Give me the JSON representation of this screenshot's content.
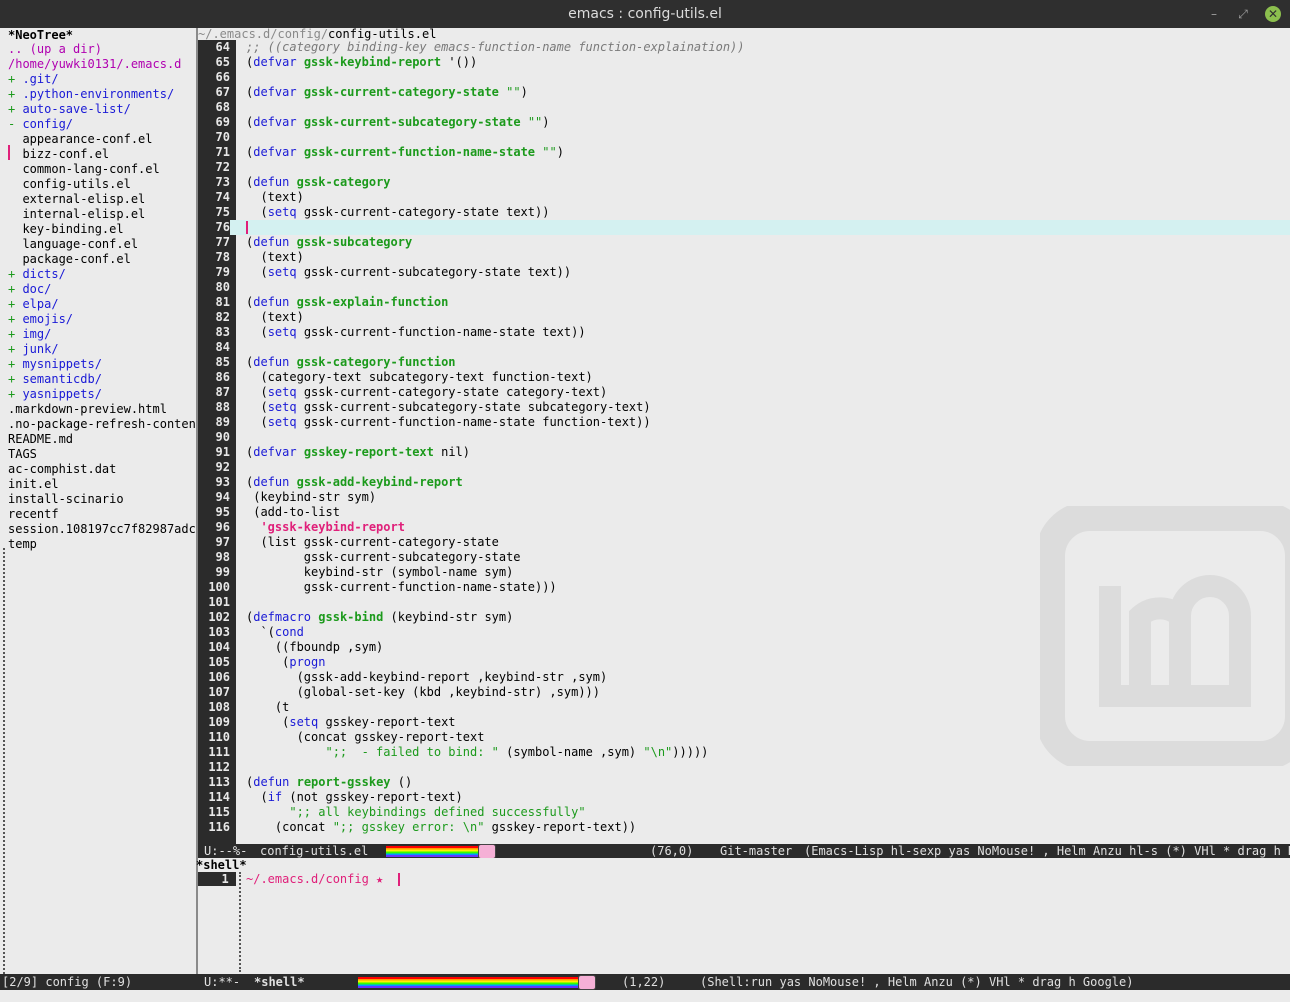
{
  "window": {
    "title": "emacs : config-utils.el",
    "min": "–",
    "max": "⤢",
    "close": "✕"
  },
  "neotree": {
    "header": "*NeoTree*",
    "lines": [
      {
        "prefix": "..",
        "label": " (up a dir)",
        "kind": "up"
      },
      {
        "prefix": "",
        "label": "/home/yuwki0131/.emacs.d",
        "kind": "root"
      },
      {
        "prefix": "+",
        "label": " .git/",
        "kind": "dir"
      },
      {
        "prefix": "+",
        "label": " .python-environments/",
        "kind": "dir"
      },
      {
        "prefix": "+",
        "label": " auto-save-list/",
        "kind": "dir"
      },
      {
        "prefix": "-",
        "label": " config/",
        "kind": "dir"
      },
      {
        "prefix": "",
        "label": "  appearance-conf.el",
        "kind": "file"
      },
      {
        "prefix": "",
        "label": "  bizz-conf.el",
        "kind": "file"
      },
      {
        "prefix": "",
        "label": "  common-lang-conf.el",
        "kind": "file"
      },
      {
        "prefix": "",
        "label": "  config-utils.el",
        "kind": "file"
      },
      {
        "prefix": "",
        "label": "  external-elisp.el",
        "kind": "file"
      },
      {
        "prefix": "",
        "label": "  internal-elisp.el",
        "kind": "file"
      },
      {
        "prefix": "",
        "label": "  key-binding.el",
        "kind": "file"
      },
      {
        "prefix": "",
        "label": "  language-conf.el",
        "kind": "file"
      },
      {
        "prefix": "",
        "label": "  package-conf.el",
        "kind": "file"
      },
      {
        "prefix": "+",
        "label": " dicts/",
        "kind": "dir"
      },
      {
        "prefix": "+",
        "label": " doc/",
        "kind": "dir"
      },
      {
        "prefix": "+",
        "label": " elpa/",
        "kind": "dir"
      },
      {
        "prefix": "+",
        "label": " emojis/",
        "kind": "dir"
      },
      {
        "prefix": "+",
        "label": " img/",
        "kind": "dir"
      },
      {
        "prefix": "+",
        "label": " junk/",
        "kind": "dir"
      },
      {
        "prefix": "+",
        "label": " mysnippets/",
        "kind": "dir"
      },
      {
        "prefix": "+",
        "label": " semanticdb/",
        "kind": "dir"
      },
      {
        "prefix": "+",
        "label": " yasnippets/",
        "kind": "dir"
      },
      {
        "prefix": "",
        "label": ".markdown-preview.html",
        "kind": "file"
      },
      {
        "prefix": "",
        "label": ".no-package-refresh-conten",
        "kind": "file"
      },
      {
        "prefix": "",
        "label": "README.md",
        "kind": "file"
      },
      {
        "prefix": "",
        "label": "TAGS",
        "kind": "file"
      },
      {
        "prefix": "",
        "label": "ac-comphist.dat",
        "kind": "file"
      },
      {
        "prefix": "",
        "label": "init.el",
        "kind": "file"
      },
      {
        "prefix": "",
        "label": "install-scinario",
        "kind": "file"
      },
      {
        "prefix": "",
        "label": "recentf",
        "kind": "file"
      },
      {
        "prefix": "",
        "label": "session.108197cc7f82987adc",
        "kind": "file"
      },
      {
        "prefix": "",
        "label": "temp",
        "kind": "file"
      }
    ]
  },
  "editor": {
    "path_dir": "~/.emacs.d/config/",
    "path_file": "config-utils.el",
    "lines": [
      {
        "n": "64",
        "t": ";; ((category binding-key emacs-function-name function-explaination))"
      },
      {
        "n": "65",
        "t": "(defvar gssk-keybind-report '())"
      },
      {
        "n": "66",
        "t": ""
      },
      {
        "n": "67",
        "t": "(defvar gssk-current-category-state \"\")"
      },
      {
        "n": "68",
        "t": ""
      },
      {
        "n": "69",
        "t": "(defvar gssk-current-subcategory-state \"\")"
      },
      {
        "n": "70",
        "t": ""
      },
      {
        "n": "71",
        "t": "(defvar gssk-current-function-name-state \"\")"
      },
      {
        "n": "72",
        "t": ""
      },
      {
        "n": "73",
        "t": "(defun gssk-category"
      },
      {
        "n": "74",
        "t": "  (text)"
      },
      {
        "n": "75",
        "t": "  (setq gssk-current-category-state text))"
      },
      {
        "n": "76",
        "t": ""
      },
      {
        "n": "77",
        "t": "(defun gssk-subcategory"
      },
      {
        "n": "78",
        "t": "  (text)"
      },
      {
        "n": "79",
        "t": "  (setq gssk-current-subcategory-state text))"
      },
      {
        "n": "80",
        "t": ""
      },
      {
        "n": "81",
        "t": "(defun gssk-explain-function"
      },
      {
        "n": "82",
        "t": "  (text)"
      },
      {
        "n": "83",
        "t": "  (setq gssk-current-function-name-state text))"
      },
      {
        "n": "84",
        "t": ""
      },
      {
        "n": "85",
        "t": "(defun gssk-category-function"
      },
      {
        "n": "86",
        "t": "  (category-text subcategory-text function-text)"
      },
      {
        "n": "87",
        "t": "  (setq gssk-current-category-state category-text)"
      },
      {
        "n": "88",
        "t": "  (setq gssk-current-subcategory-state subcategory-text)"
      },
      {
        "n": "89",
        "t": "  (setq gssk-current-function-name-state function-text))"
      },
      {
        "n": "90",
        "t": ""
      },
      {
        "n": "91",
        "t": "(defvar gsskey-report-text nil)"
      },
      {
        "n": "92",
        "t": ""
      },
      {
        "n": "93",
        "t": "(defun gssk-add-keybind-report"
      },
      {
        "n": "94",
        "t": " (keybind-str sym)"
      },
      {
        "n": "95",
        "t": " (add-to-list"
      },
      {
        "n": "96",
        "t": "  'gssk-keybind-report"
      },
      {
        "n": "97",
        "t": "  (list gssk-current-category-state"
      },
      {
        "n": "98",
        "t": "        gssk-current-subcategory-state"
      },
      {
        "n": "99",
        "t": "        keybind-str (symbol-name sym)"
      },
      {
        "n": "100",
        "t": "        gssk-current-function-name-state)))"
      },
      {
        "n": "101",
        "t": ""
      },
      {
        "n": "102",
        "t": "(defmacro gssk-bind (keybind-str sym)"
      },
      {
        "n": "103",
        "t": "  `(cond"
      },
      {
        "n": "104",
        "t": "    ((fboundp ,sym)"
      },
      {
        "n": "105",
        "t": "     (progn"
      },
      {
        "n": "106",
        "t": "       (gssk-add-keybind-report ,keybind-str ,sym)"
      },
      {
        "n": "107",
        "t": "       (global-set-key (kbd ,keybind-str) ,sym)))"
      },
      {
        "n": "108",
        "t": "    (t"
      },
      {
        "n": "109",
        "t": "     (setq gsskey-report-text"
      },
      {
        "n": "110",
        "t": "       (concat gsskey-report-text"
      },
      {
        "n": "111",
        "t": "           \";;  - failed to bind: \" (symbol-name ,sym) \"\\n\")))))"
      },
      {
        "n": "112",
        "t": ""
      },
      {
        "n": "113",
        "t": "(defun report-gsskey ()"
      },
      {
        "n": "114",
        "t": "  (if (not gsskey-report-text)"
      },
      {
        "n": "115",
        "t": "      \";; all keybindings defined successfully\""
      },
      {
        "n": "116",
        "t": "    (concat \";; gsskey error: \\n\" gsskey-report-text))"
      }
    ]
  },
  "modeline_top": {
    "state": "U:--%-",
    "buffer": "config-utils.el",
    "position": "(76,0)",
    "vc": "Git-master",
    "modes": "(Emacs-Lisp hl-sexp yas NoMouse! , Helm Anzu hl-s (*) VHl * drag h HS"
  },
  "shell": {
    "header": "*shell*",
    "line_no": "1",
    "prompt": "~/.emacs.d/config ★ "
  },
  "modeline_bottom": {
    "neo_status": "[2/9] config (F:9)",
    "state": "U:**-",
    "buffer": "*shell*",
    "position": "(1,22)",
    "modes": "(Shell:run yas NoMouse! , Helm Anzu (*) VHl * drag h Google)"
  },
  "colors": {
    "keyword": "#1a1ad6",
    "function": "#1c9a1c",
    "string": "#1c9a1c",
    "symbol": "#e0207a",
    "modeline_bg": "#2b2b2b",
    "highlight_line": "#d4f1f1"
  }
}
